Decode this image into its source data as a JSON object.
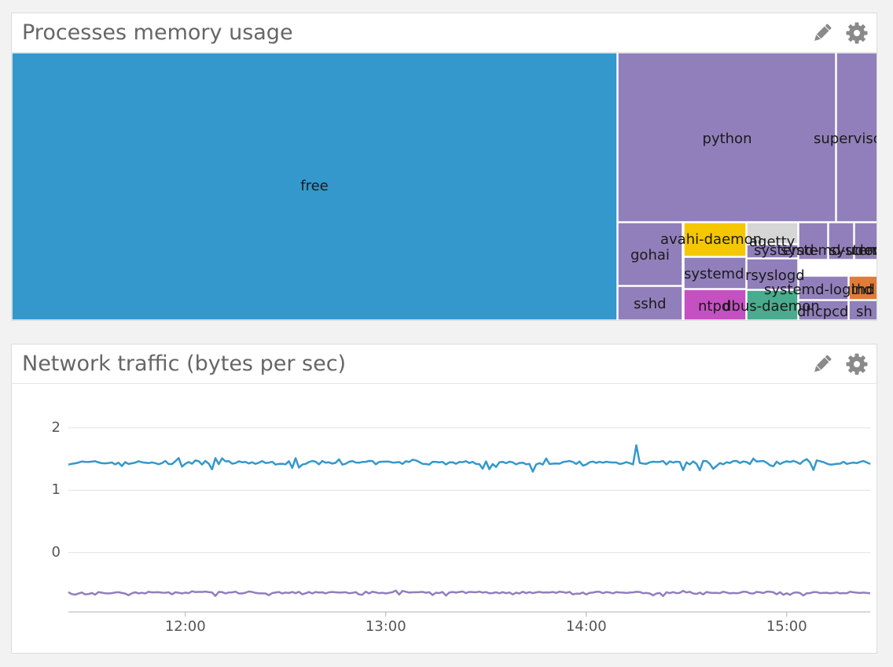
{
  "widgets": {
    "memory": {
      "title": "Processes memory usage",
      "edit_icon": "pencil-icon",
      "settings_icon": "gear-icon"
    },
    "network": {
      "title": "Network traffic (bytes per sec)",
      "edit_icon": "pencil-icon",
      "settings_icon": "gear-icon"
    }
  },
  "chart_data": [
    {
      "type": "treemap",
      "title": "Processes memory usage",
      "cells": [
        {
          "label": "free",
          "color": "#3498cc"
        },
        {
          "label": "python",
          "color": "#917fbb"
        },
        {
          "label": "supervisor",
          "color": "#917fbb"
        },
        {
          "label": "gohai",
          "color": "#917fbb"
        },
        {
          "label": "sshd",
          "color": "#917fbb"
        },
        {
          "label": "avahi-daemon",
          "color": "#f5c700"
        },
        {
          "label": "systemd",
          "color": "#917fbb"
        },
        {
          "label": "ntpd",
          "color": "#c550c1"
        },
        {
          "label": "agetty",
          "color": "#d6d6d6"
        },
        {
          "label": "systemd-",
          "color": "#917fbb"
        },
        {
          "label": "rsyslogd",
          "color": "#917fbb"
        },
        {
          "label": "dbus-daemon",
          "color": "#4aab8e"
        },
        {
          "label": "systemd-udevd",
          "color": "#917fbb"
        },
        {
          "label": "systemd-journald",
          "color": "#917fbb"
        },
        {
          "label": "cron",
          "color": "#917fbb"
        },
        {
          "label": "systemd-logind",
          "color": "#917fbb"
        },
        {
          "label": "dhcpcd",
          "color": "#917fbb"
        },
        {
          "label": "thd",
          "color": "#e07b3a"
        },
        {
          "label": "sh",
          "color": "#917fbb"
        }
      ]
    },
    {
      "type": "line",
      "title": "Network traffic (bytes per sec)",
      "x_range": [
        "11:25",
        "15:25"
      ],
      "x_ticks": [
        "12:00",
        "13:00",
        "14:00",
        "15:00"
      ],
      "y_ticks": [
        "2",
        "1",
        "0"
      ],
      "ylim": [
        -0.95,
        2.2
      ],
      "grid": true,
      "series": [
        {
          "color": "#3498cc",
          "baseline": 1.44,
          "spike_at": "14:15",
          "spike_value": 1.72
        },
        {
          "color": "#917fbb",
          "baseline": -0.64
        }
      ]
    }
  ]
}
